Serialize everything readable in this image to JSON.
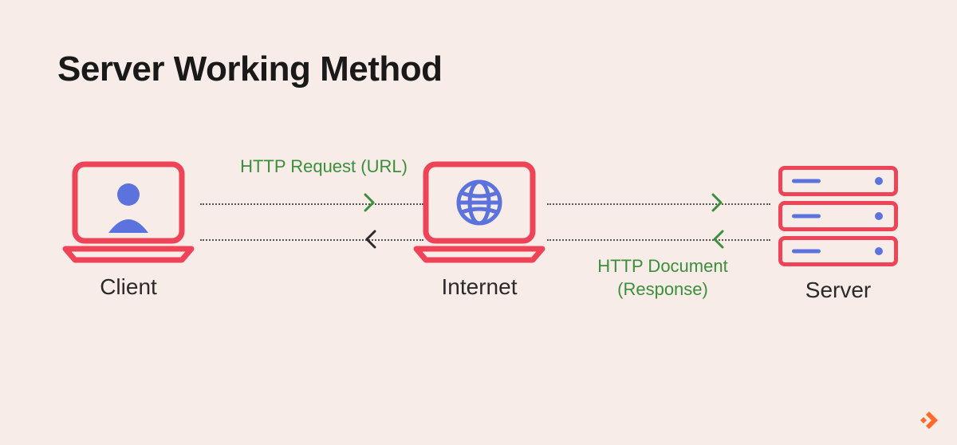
{
  "title": "Server Working Method",
  "nodes": {
    "client": "Client",
    "internet": "Internet",
    "server": "Server"
  },
  "flows": {
    "request": "HTTP Request (URL)",
    "response": "HTTP Document (Response)"
  },
  "colors": {
    "bg": "#f8ece8",
    "outline": "#ef4358",
    "accent": "#5c73dd",
    "flowText": "#3a8f3a",
    "text": "#191919"
  }
}
